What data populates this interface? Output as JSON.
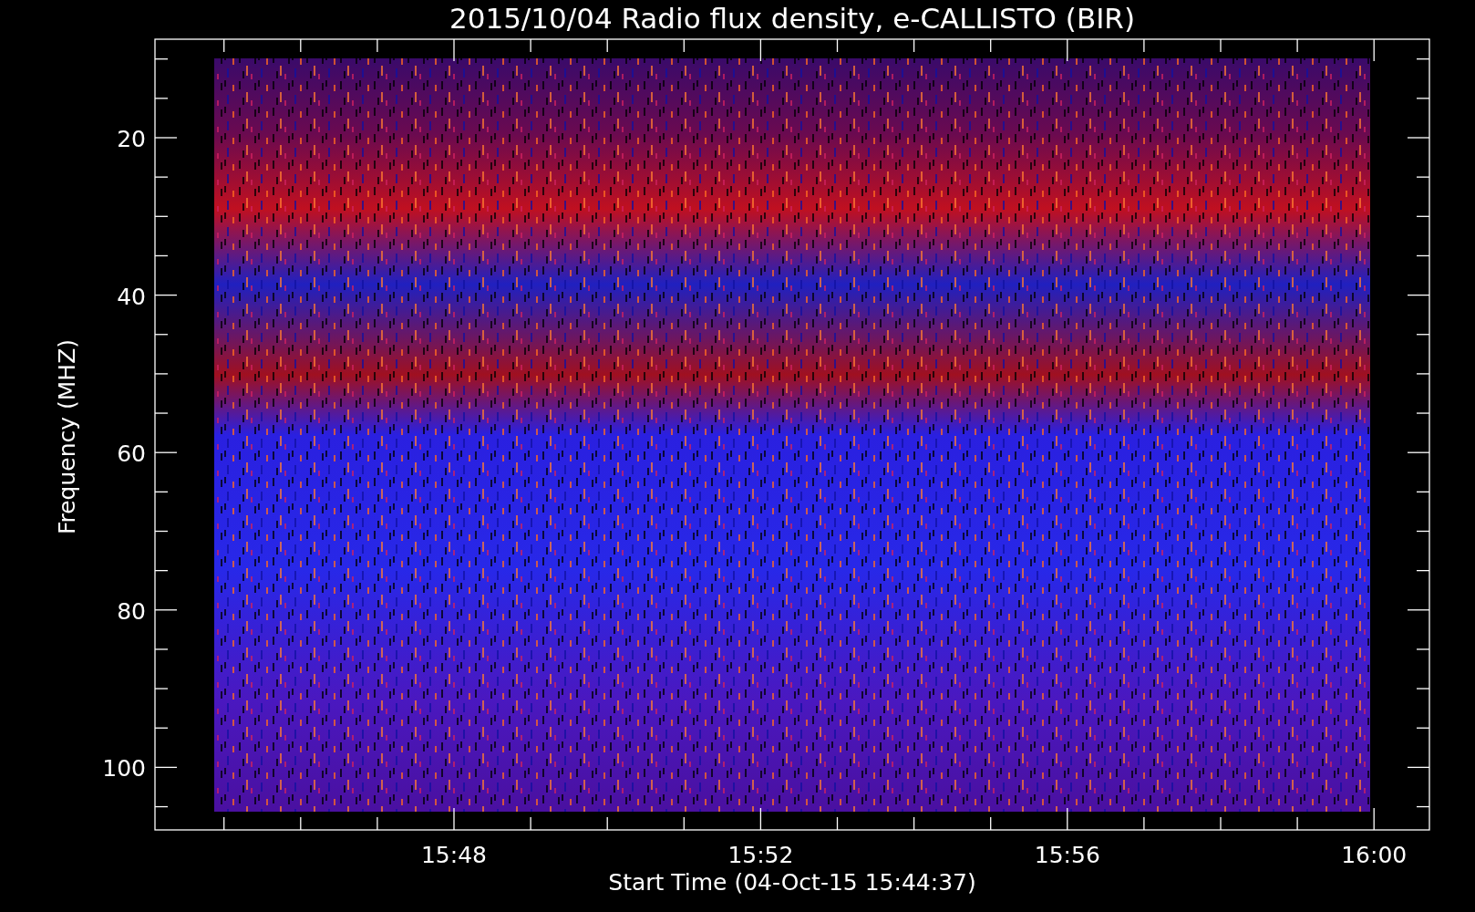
{
  "chart": {
    "title": "2015/10/04  Radio flux density, e-CALLISTO (BIR)",
    "y_axis": {
      "label": "Frequency (MHZ)",
      "ticks": [
        "20",
        "40",
        "60",
        "80",
        "100"
      ]
    },
    "x_axis": {
      "label": "Start Time (04-Oct-15 15:44:37)",
      "ticks": [
        "15:48",
        "15:52",
        "15:56",
        "16:00"
      ]
    }
  }
}
